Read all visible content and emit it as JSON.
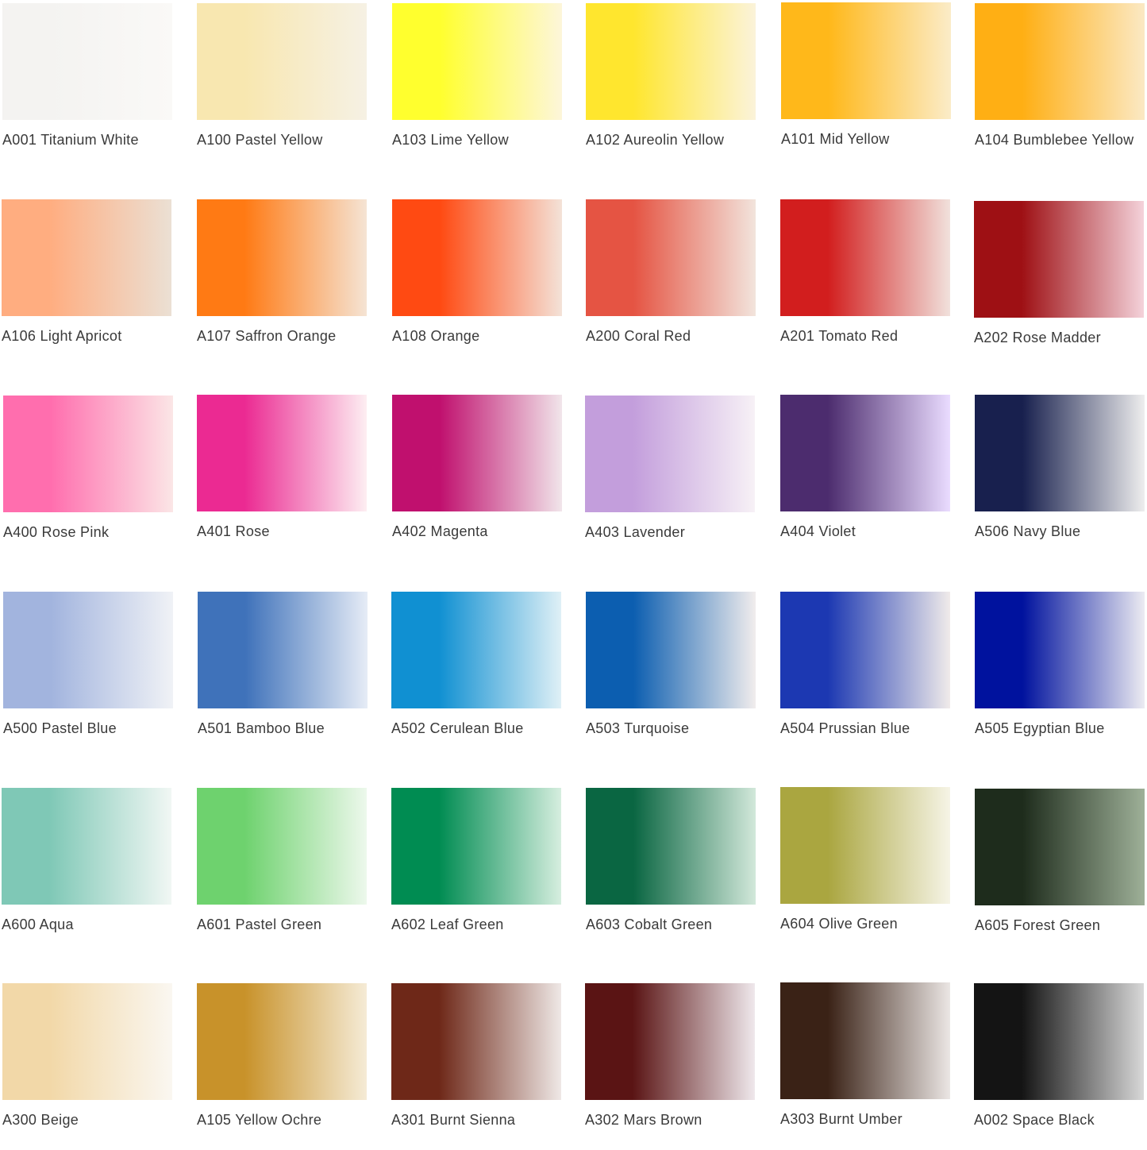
{
  "swatches": [
    {
      "label": "A001 Titanium White",
      "color": "#f4f3f1",
      "fade": "#faf9f7"
    },
    {
      "label": "A100 Pastel Yellow",
      "color": "#f8e7b0",
      "fade": "#f6f1e4"
    },
    {
      "label": "A103 Lime Yellow",
      "color": "#ffff2e",
      "fade": "#fdf6da"
    },
    {
      "label": "A102 Aureolin Yellow",
      "color": "#ffe62e",
      "fade": "#fbf3da"
    },
    {
      "label": "A101 Mid Yellow",
      "color": "#ffb81a",
      "fade": "#fbecc8"
    },
    {
      "label": "A104 Bumblebee Yellow",
      "color": "#ffaf14",
      "fade": "#fbe9c4"
    },
    {
      "label": "A106 Light Apricot",
      "color": "#ffad80",
      "fade": "#ebe0d4"
    },
    {
      "label": "A107 Saffron Orange",
      "color": "#ff7a14",
      "fade": "#f5e4d4"
    },
    {
      "label": "A108 Orange",
      "color": "#ff4a12",
      "fade": "#f4e2d8"
    },
    {
      "label": "A200 Coral Red",
      "color": "#e55443",
      "fade": "#f2e4dc"
    },
    {
      "label": "A201 Tomato Red",
      "color": "#d21e1e",
      "fade": "#f1e1dc"
    },
    {
      "label": "A202 Rose Madder",
      "color": "#9e1014",
      "fade": "#f4d2da"
    },
    {
      "label": "A400 Rose Pink",
      "color": "#ff6eae",
      "fade": "#fbe6e6"
    },
    {
      "label": "A401 Rose",
      "color": "#eb2a92",
      "fade": "#fdeef2"
    },
    {
      "label": "A402 Magenta",
      "color": "#c0106e",
      "fade": "#f1e5ea"
    },
    {
      "label": "A403 Lavender",
      "color": "#c39edc",
      "fade": "#f7f1f6"
    },
    {
      "label": "A404 Violet",
      "color": "#4c2c6e",
      "fade": "#eadcff"
    },
    {
      "label": "A506 Navy Blue",
      "color": "#18204e",
      "fade": "#eeeeee"
    },
    {
      "label": "A500 Pastel Blue",
      "color": "#a2b4de",
      "fade": "#f0f2f6"
    },
    {
      "label": "A501 Bamboo Blue",
      "color": "#3f72ba",
      "fade": "#e6ecf6"
    },
    {
      "label": "A502 Cerulean Blue",
      "color": "#1090d2",
      "fade": "#dff0f6"
    },
    {
      "label": "A503 Turquoise",
      "color": "#0c5eb0",
      "fade": "#f1eded"
    },
    {
      "label": "A504 Prussian Blue",
      "color": "#1c38b2",
      "fade": "#f0ebea"
    },
    {
      "label": "A505 Egyptian Blue",
      "color": "#00129e",
      "fade": "#ecebf2"
    },
    {
      "label": "A600 Aqua",
      "color": "#7fc8b6",
      "fade": "#f1f7f4"
    },
    {
      "label": "A601 Pastel Green",
      "color": "#6ed26e",
      "fade": "#edf8ec"
    },
    {
      "label": "A602 Leaf Green",
      "color": "#008c52",
      "fade": "#d6eedf"
    },
    {
      "label": "A603 Cobalt Green",
      "color": "#0a6642",
      "fade": "#d2e8da"
    },
    {
      "label": "A604 Olive Green",
      "color": "#aaa640",
      "fade": "#f6f4e6"
    },
    {
      "label": "A605 Forest Green",
      "color": "#1e2c1c",
      "fade": "#9eb098"
    },
    {
      "label": "A300 Beige",
      "color": "#f2d8a8",
      "fade": "#faf7f1"
    },
    {
      "label": "A105 Yellow Ochre",
      "color": "#c8922a",
      "fade": "#f5ebd6"
    },
    {
      "label": "A301 Burnt Sienna",
      "color": "#6e2818",
      "fade": "#efe8e6"
    },
    {
      "label": "A302 Mars Brown",
      "color": "#5a1414",
      "fade": "#efe8ec"
    },
    {
      "label": "A303 Burnt Umber",
      "color": "#3a2216",
      "fade": "#ebe6e4"
    },
    {
      "label": "A002 Space Black",
      "color": "#141414",
      "fade": "#d8d8d8"
    }
  ]
}
